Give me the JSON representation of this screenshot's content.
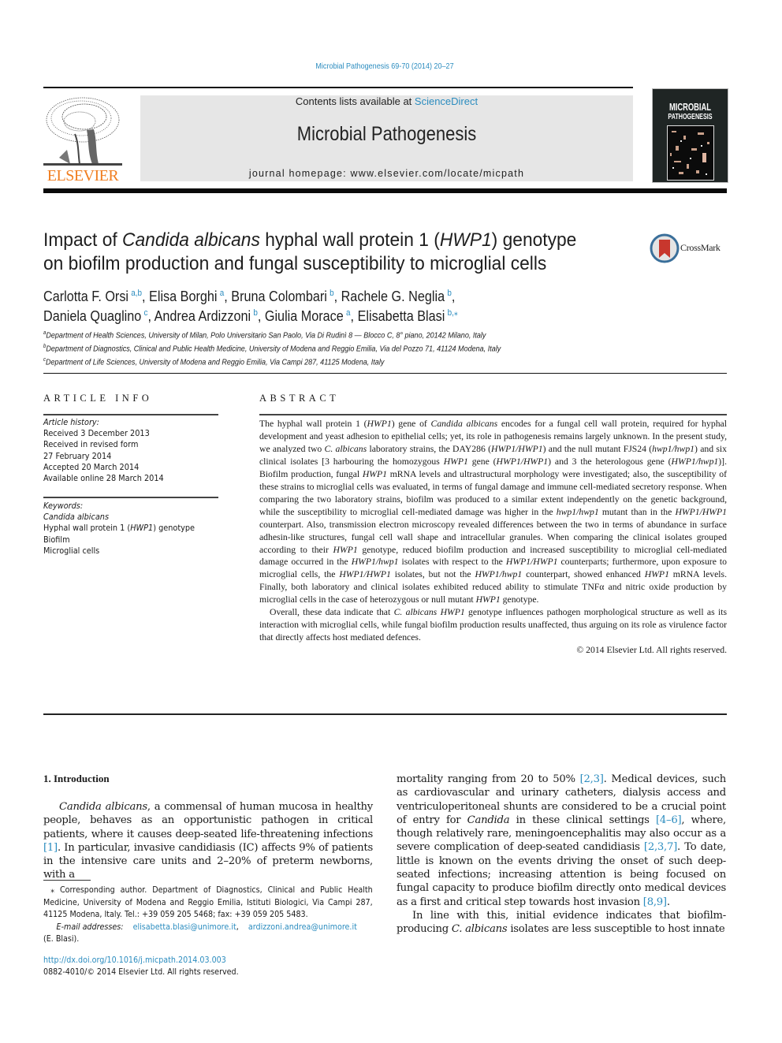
{
  "header": {
    "citation": "Microbial Pathogenesis 69-70 (2014) 20–27",
    "contents_prefix": "Contents lists available at ",
    "contents_link": "ScienceDirect",
    "journal_title": "Microbial Pathogenesis",
    "homepage": "journal homepage: www.elsevier.com/locate/micpath",
    "publisher_logo_text": "ELSEVIER",
    "cover_title_line1": "MICROBIAL",
    "cover_title_line2": "PATHOGENESIS",
    "crossmark_label": "CrossMark",
    "colors": {
      "link": "#2b8cbf",
      "elsevier_orange": "#f07d1f",
      "masthead_bg": "#e6e6e6"
    }
  },
  "article": {
    "title_parts": [
      "Impact of ",
      "Candida albicans",
      " hyphal wall protein 1 (",
      "HWP1",
      ") genotype on biofilm production and fungal susceptibility to microglial cells"
    ],
    "authors": [
      {
        "name": "Carlotta F. Orsi",
        "aff": "a,b",
        "sep": ", "
      },
      {
        "name": "Elisa Borghi",
        "aff": "a",
        "sep": ", "
      },
      {
        "name": "Bruna Colombari",
        "aff": "b",
        "sep": ", "
      },
      {
        "name": "Rachele G. Neglia",
        "aff": "b",
        "sep": ","
      },
      {
        "name": "Daniela Quaglino",
        "aff": "c",
        "sep": ", "
      },
      {
        "name": "Andrea Ardizzoni",
        "aff": "b",
        "sep": ", "
      },
      {
        "name": "Giulia Morace",
        "aff": "a",
        "sep": ", "
      },
      {
        "name": "Elisabetta Blasi",
        "aff": "b,⁎",
        "sep": ""
      }
    ],
    "affiliations": [
      {
        "key": "a",
        "text": "Department of Health Sciences, University of Milan, Polo Universitario San Paolo, Via Di Rudinì 8 — Blocco C, 8° piano, 20142 Milano, Italy"
      },
      {
        "key": "b",
        "text": "Department of Diagnostics, Clinical and Public Health Medicine, University of Modena and Reggio Emilia, Via del Pozzo 71, 41124 Modena, Italy"
      },
      {
        "key": "c",
        "text": "Department of Life Sciences, University of Modena and Reggio Emilia, Via Campi 287, 41125 Modena, Italy"
      }
    ]
  },
  "article_info": {
    "heading": "ARTICLE INFO",
    "history_label": "Article history:",
    "history": [
      "Received 3 December 2013",
      "Received in revised form",
      "27 February 2014",
      "Accepted 20 March 2014",
      "Available online 28 March 2014"
    ],
    "keywords_label": "Keywords:",
    "keywords": [
      "Candida albicans",
      "Hyphal wall protein 1 (HWP1) genotype",
      "Biofilm",
      "Microglial cells"
    ]
  },
  "abstract": {
    "heading": "ABSTRACT",
    "p1": "The hyphal wall protein 1 (HWP1) gene of Candida albicans encodes for a fungal cell wall protein, required for hyphal development and yeast adhesion to epithelial cells; yet, its role in pathogenesis remains largely unknown. In the present study, we analyzed two C. albicans laboratory strains, the DAY286 (HWP1/HWP1) and the null mutant FJS24 (hwp1/hwp1) and six clinical isolates [3 harbouring the homozygous HWP1 gene (HWP1/HWP1) and 3 the heterologous gene (HWP1/hwp1)]. Biofilm production, fungal HWP1 mRNA levels and ultrastructural morphology were investigated; also, the susceptibility of these strains to microglial cells was evaluated, in terms of fungal damage and immune cell-mediated secretory response. When comparing the two laboratory strains, biofilm was produced to a similar extent independently on the genetic background, while the susceptibility to microglial cell-mediated damage was higher in the hwp1/hwp1 mutant than in the HWP1/HWP1 counterpart. Also, transmission electron microscopy revealed differences between the two in terms of abundance in surface adhesin-like structures, fungal cell wall shape and intracellular granules. When comparing the clinical isolates grouped according to their HWP1 genotype, reduced biofilm production and increased susceptibility to microglial cell-mediated damage occurred in the HWP1/hwp1 isolates with respect to the HWP1/HWP1 counterparts; furthermore, upon exposure to microglial cells, the HWP1/HWP1 isolates, but not the HWP1/hwp1 counterpart, showed enhanced HWP1 mRNA levels. Finally, both laboratory and clinical isolates exhibited reduced ability to stimulate TNFα and nitric oxide production by microglial cells in the case of heterozygous or null mutant HWP1 genotype.",
    "p2": "Overall, these data indicate that C. albicans HWP1 genotype influences pathogen morphological structure as well as its interaction with microglial cells, while fungal biofilm production results unaffected, thus arguing on its role as virulence factor that directly affects host mediated defences.",
    "copyright": "© 2014 Elsevier Ltd. All rights reserved."
  },
  "introduction": {
    "heading": "1.  Introduction",
    "left_p1": "Candida albicans, a commensal of human mucosa in healthy people, behaves as an opportunistic pathogen in critical patients, where it causes deep-seated life-threatening infections [1]. In particular, invasive candidiasis (IC) affects 9% of patients in the intensive care units and 2–20% of preterm newborns, with a",
    "right_p1": "mortality ranging from 20 to 50% [2,3]. Medical devices, such as cardiovascular and urinary catheters, dialysis access and ventriculoperitoneal shunts are considered to be a crucial point of entry for Candida in these clinical settings [4–6], where, though relatively rare, meningoencephalitis may also occur as a severe complication of deep-seated candidiasis [2,3,7]. To date, little is known on the events driving the onset of such deep-seated infections; increasing attention is being focused on fungal capacity to produce biofilm directly onto medical devices as a first and critical step towards host invasion [8,9].",
    "right_p2": "In line with this, initial evidence indicates that biofilm-producing C. albicans isolates are less susceptible to host innate",
    "refs": [
      "[1]",
      "[2,3]",
      "[4–6]",
      "[2,3,7]",
      "[8,9]"
    ]
  },
  "footnote": {
    "corresponding": "⁎ Corresponding author. Department of Diagnostics, Clinical and Public Health Medicine, University of Modena and Reggio Emilia, Istituti Biologici, Via Campi 287, 41125 Modena, Italy. Tel.: +39 059 205 5468; fax: +39 059 205 5483.",
    "email_label": "E-mail addresses:",
    "emails": [
      "elisabetta.blasi@unimore.it",
      "ardizzoni.andrea@unimore.it"
    ],
    "email_owner": "(E. Blasi).",
    "doi": "http://dx.doi.org/10.1016/j.micpath.2014.03.003",
    "issn_copyright": "0882-4010/© 2014 Elsevier Ltd. All rights reserved."
  }
}
